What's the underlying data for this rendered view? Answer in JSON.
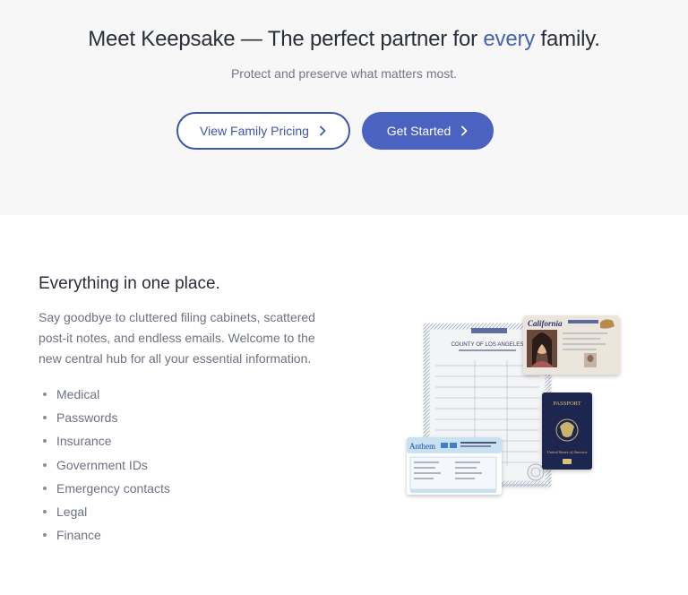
{
  "hero": {
    "title_before": "Meet Keepsake — The perfect partner for ",
    "title_accent": "every",
    "title_after": " family.",
    "subtitle": "Protect and preserve what matters most.",
    "secondary_button": "View Family Pricing",
    "primary_button": "Get Started"
  },
  "feature": {
    "title": "Everything in one place.",
    "description": "Say goodbye to cluttered filing cabinets, scattered post-it notes, and endless emails. Welcome to the new central hub for all your essential information.",
    "items": [
      "Medical",
      "Passwords",
      "Insurance",
      "Government IDs",
      "Emergency contacts",
      "Legal",
      "Finance"
    ]
  },
  "documents": {
    "certificate_header": "COUNTY OF LOS ANGELES",
    "license_state": "California",
    "passport_label": "PASSPORT",
    "passport_country": "United States of America",
    "insurance_brand": "Anthem"
  },
  "colors": {
    "accent": "#4561b8",
    "button_primary": "#4a63c0",
    "hero_background": "#f7f7f8",
    "passport": "#1c2550"
  },
  "icons": {
    "button_arrow": "chevron-right-icon"
  }
}
